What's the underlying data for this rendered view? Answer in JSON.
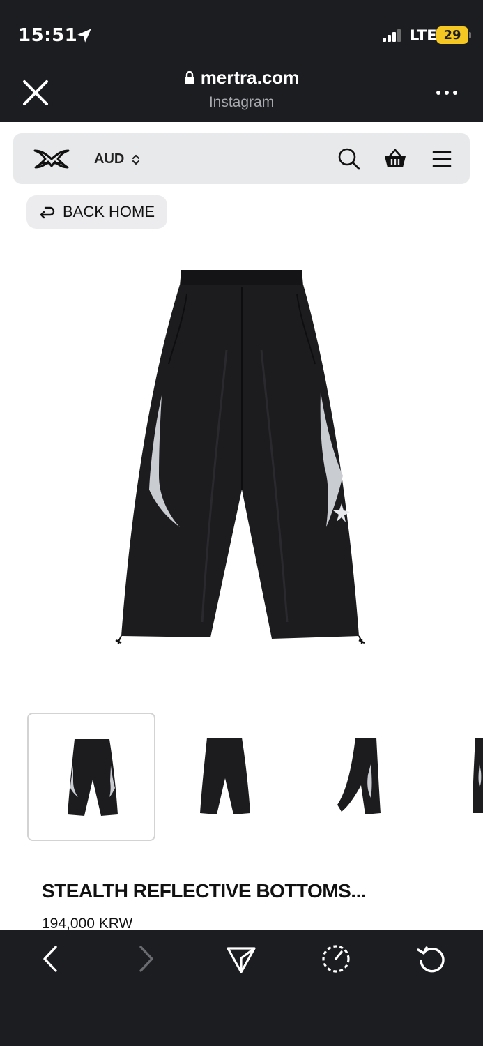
{
  "status_bar": {
    "time": "15:51",
    "network": "LTE",
    "battery": "29",
    "icons": [
      "location-arrow-icon",
      "signal-bars-icon",
      "battery-icon"
    ]
  },
  "browser": {
    "url": "mertra.com",
    "source_app": "Instagram",
    "icons": [
      "close-icon",
      "lock-icon",
      "more-icon"
    ]
  },
  "site_nav": {
    "currency": "AUD",
    "icons": [
      "mertra-logo",
      "chevron-updown-icon",
      "search-icon",
      "basket-icon",
      "menu-icon"
    ]
  },
  "back_home": {
    "label": "BACK HOME",
    "icon": "return-arrow-icon"
  },
  "product": {
    "title": "STEALTH REFLECTIVE BOTTOMS...",
    "price": "194,000 KRW",
    "thumbnails": [
      {
        "view": "front",
        "selected": true
      },
      {
        "view": "back",
        "selected": false
      },
      {
        "view": "side",
        "selected": false
      },
      {
        "view": "detail",
        "selected": false
      }
    ]
  },
  "toolbar": {
    "icons": [
      "back-arrow-icon",
      "forward-arrow-icon",
      "share-icon",
      "speed-gauge-icon",
      "reload-icon"
    ]
  },
  "colors": {
    "chrome_dark": "#1c1d21",
    "nav_bg": "#e8e9eb",
    "battery_yellow": "#f4c722",
    "pants": "#1a1a1c",
    "reflective": "#c9ccd1"
  }
}
